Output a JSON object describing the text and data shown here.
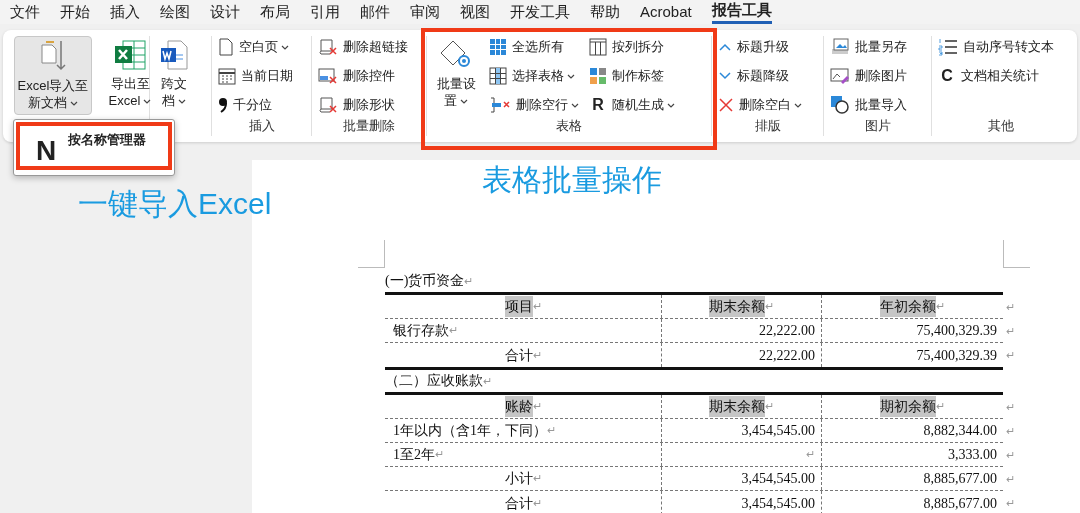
{
  "menu_tabs": [
    {
      "label": "文件",
      "selected": false
    },
    {
      "label": "开始",
      "selected": false
    },
    {
      "label": "插入",
      "selected": false
    },
    {
      "label": "绘图",
      "selected": false
    },
    {
      "label": "设计",
      "selected": false
    },
    {
      "label": "布局",
      "selected": false
    },
    {
      "label": "引用",
      "selected": false
    },
    {
      "label": "邮件",
      "selected": false
    },
    {
      "label": "审阅",
      "selected": false
    },
    {
      "label": "视图",
      "selected": false
    },
    {
      "label": "开发工具",
      "selected": false
    },
    {
      "label": "帮助",
      "selected": false
    },
    {
      "label": "Acrobat",
      "selected": false
    },
    {
      "label": "报告工具",
      "selected": true
    }
  ],
  "ribbon_groups": [
    {
      "highlighted": false,
      "columns": [
        [
          {
            "kind": "large",
            "label": "Excel导入至新文档",
            "dropdown": true,
            "expanded": true,
            "menu": [
              {
                "glyph": "N",
                "label": "按名称管理器",
                "highlighted": true
              }
            ]
          }
        ],
        [
          {
            "kind": "large",
            "label": "导出至Excel",
            "dropdown": true,
            "expanded": false
          }
        ]
      ]
    },
    {
      "highlighted": false,
      "columns": [
        [
          {
            "kind": "large",
            "label": "跨文档",
            "dropdown": true,
            "expanded": false
          }
        ]
      ]
    },
    {
      "label": "插入",
      "highlighted": false,
      "columns": [
        [
          {
            "kind": "small",
            "label": "空白页",
            "dropdown": true
          },
          {
            "kind": "small",
            "label": "当前日期",
            "dropdown": false
          },
          {
            "kind": "small",
            "label": "千分位",
            "dropdown": false
          }
        ]
      ]
    },
    {
      "label": "批量删除",
      "highlighted": false,
      "columns": [
        [
          {
            "kind": "small",
            "label": "删除超链接",
            "dropdown": false
          },
          {
            "kind": "small",
            "label": "删除控件",
            "dropdown": false
          },
          {
            "kind": "small",
            "label": "删除形状",
            "dropdown": false
          }
        ]
      ]
    },
    {
      "label": "表格",
      "highlighted": true,
      "columns": [
        [
          {
            "kind": "large",
            "label": "批量设置",
            "dropdown": true,
            "expanded": false
          }
        ],
        [
          {
            "kind": "small",
            "label": "全选所有",
            "dropdown": false
          },
          {
            "kind": "small",
            "label": "选择表格",
            "dropdown": true
          },
          {
            "kind": "small",
            "label": "删除空行",
            "dropdown": true
          }
        ],
        [
          {
            "kind": "small",
            "label": "按列拆分",
            "dropdown": false
          },
          {
            "kind": "small",
            "label": "制作标签",
            "dropdown": false
          },
          {
            "kind": "small",
            "label": "随机生成",
            "dropdown": true,
            "glyph": "R"
          }
        ]
      ]
    },
    {
      "label": "排版",
      "highlighted": false,
      "columns": [
        [
          {
            "kind": "small",
            "label": "标题升级",
            "dropdown": false
          },
          {
            "kind": "small",
            "label": "标题降级",
            "dropdown": false
          },
          {
            "kind": "small",
            "label": "删除空白",
            "dropdown": true
          }
        ]
      ]
    },
    {
      "label": "图片",
      "highlighted": false,
      "columns": [
        [
          {
            "kind": "small",
            "label": "批量另存",
            "dropdown": false
          },
          {
            "kind": "small",
            "label": "删除图片",
            "dropdown": false
          },
          {
            "kind": "small",
            "label": "批量导入",
            "dropdown": false
          }
        ]
      ]
    },
    {
      "label": "其他",
      "highlighted": false,
      "columns": [
        [
          {
            "kind": "small",
            "label": "自动序号转文本",
            "dropdown": false
          },
          {
            "kind": "small",
            "label": "文档相关统计",
            "dropdown": false,
            "glyph": "C"
          }
        ]
      ]
    }
  ],
  "annotations": [
    {
      "kind": "callout_text",
      "text": "一键导入Excel"
    },
    {
      "kind": "callout_text",
      "text": "表格批量操作"
    }
  ],
  "document": {
    "sections": [
      {
        "heading": "(一)货币资金",
        "heading_mark": "↵",
        "table": {
          "header": [
            {
              "text": "项目",
              "mark": "↵",
              "highlighted": true
            },
            {
              "text": "期末余额",
              "mark": "↵",
              "highlighted": true
            },
            {
              "text": "年初余额",
              "mark": "↵",
              "highlighted": true
            }
          ],
          "header_end": "↵",
          "rows": [
            {
              "cells": [
                {
                  "text": "银行存款",
                  "mark": "↵",
                  "centered": false
                },
                {
                  "text": "22,222.00"
                },
                {
                  "text": "75,400,329.39"
                }
              ],
              "end_mark": "↵"
            },
            {
              "cells": [
                {
                  "text": "合计",
                  "mark": "↵",
                  "centered": true
                },
                {
                  "text": "22,222.00"
                },
                {
                  "text": "75,400,329.39"
                }
              ],
              "end_mark": "↵"
            }
          ]
        }
      },
      {
        "heading": "（二）应收账款",
        "heading_mark": "↵",
        "table": {
          "header": [
            {
              "text": "账龄",
              "mark": "↵",
              "highlighted": true
            },
            {
              "text": "期末余额",
              "mark": "↵",
              "highlighted": true
            },
            {
              "text": "期初余额",
              "mark": "↵",
              "highlighted": true
            }
          ],
          "header_end": "↵",
          "rows": [
            {
              "cells": [
                {
                  "text": "1年以内（含1年，下同）",
                  "mark": "↵",
                  "centered": false
                },
                {
                  "text": "3,454,545.00"
                },
                {
                  "text": "8,882,344.00"
                }
              ],
              "end_mark": "↵"
            },
            {
              "cells": [
                {
                  "text": "1至2年",
                  "mark": "↵",
                  "centered": false
                },
                {
                  "mark": "↵"
                },
                {
                  "text": "3,333.00"
                }
              ],
              "end_mark": "↵"
            },
            {
              "cells": [
                {
                  "text": "小计",
                  "mark": "↵",
                  "centered": true
                },
                {
                  "text": "3,454,545.00"
                },
                {
                  "text": "8,885,677.00"
                }
              ],
              "end_mark": "↵"
            },
            {
              "cells": [
                {
                  "text": "合计",
                  "mark": "↵",
                  "centered": true
                },
                {
                  "text": "3,454,545.00"
                },
                {
                  "text": "8,885,677.00"
                }
              ],
              "end_mark": "↵"
            }
          ]
        }
      }
    ]
  }
}
